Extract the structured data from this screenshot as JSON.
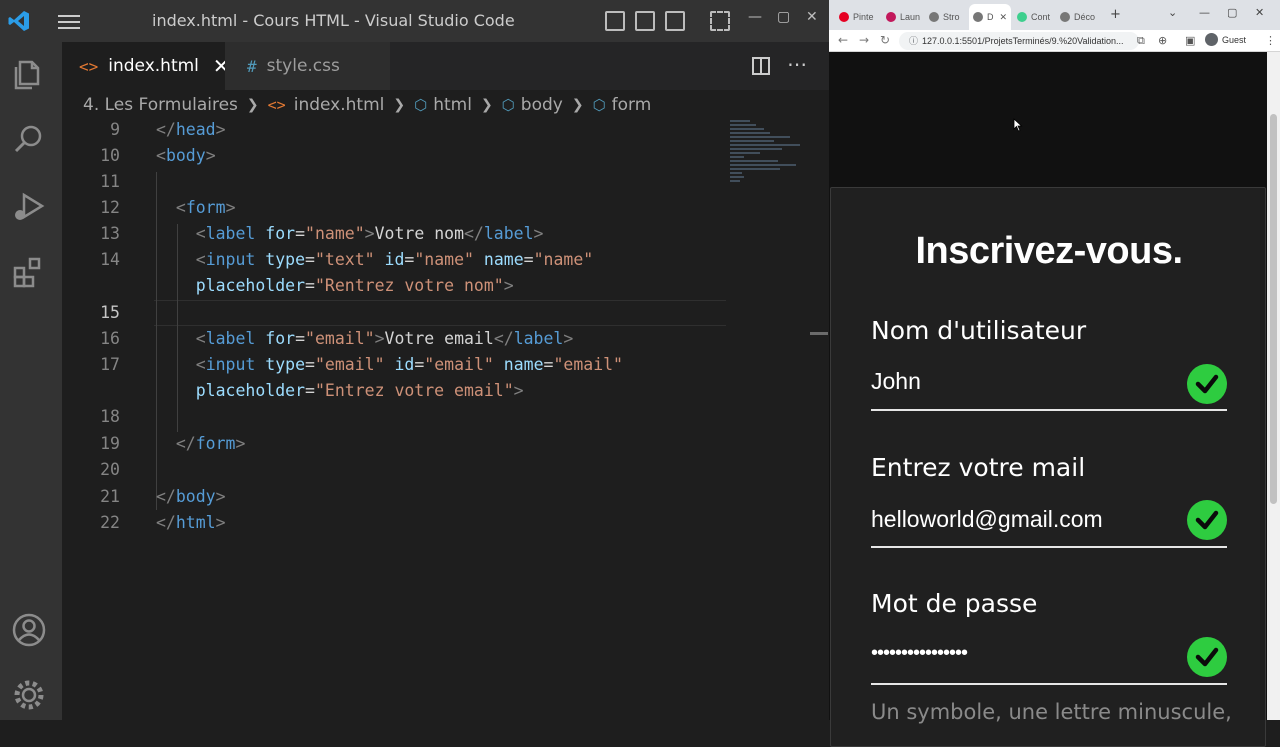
{
  "vscode": {
    "window_title": "index.html - Cours HTML - Visual Studio Code",
    "tabs": [
      {
        "icon": "<>",
        "label": "index.html",
        "active": true,
        "close": "✕"
      },
      {
        "icon": "#",
        "label": "style.css",
        "active": false
      }
    ],
    "breadcrumb": {
      "folder": "4. Les Formulaires",
      "file": "index.html",
      "items": [
        "html",
        "body",
        "form"
      ]
    },
    "current_line": 15
  },
  "browser": {
    "tabs": [
      "Pinte",
      "Laun",
      "Stro",
      "D",
      "Cont",
      "Déco"
    ],
    "url": "127.0.0.1:5501/ProjetsTerminés/9.%20Validation...",
    "profile": "Guest"
  },
  "page": {
    "title": "Inscrivez-vous.",
    "fields": [
      {
        "label": "Nom d'utilisateur",
        "value": "John",
        "valid": true
      },
      {
        "label": "Entrez votre mail",
        "value": "helloworld@gmail.com",
        "valid": true
      },
      {
        "label": "Mot de passe",
        "value": "••••••••••••••••",
        "valid": true
      }
    ],
    "hint": "Un symbole, une lettre minuscule,"
  },
  "colors": {
    "tag": "#569cd6",
    "attr": "#9cdcfe",
    "string": "#ce9178",
    "check_green": "#2ecc40"
  }
}
